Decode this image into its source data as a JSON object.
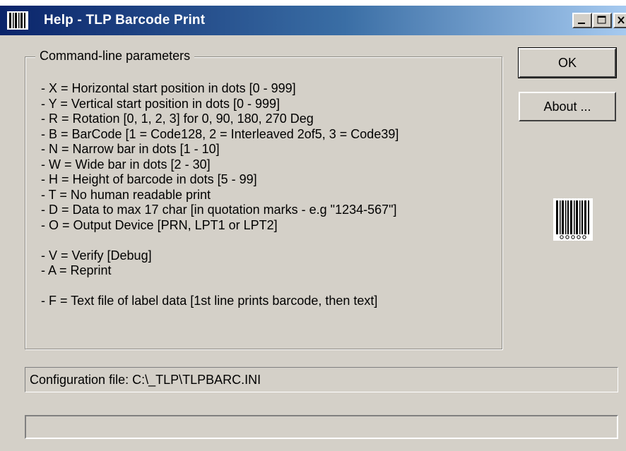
{
  "window": {
    "title": "Help - TLP Barcode Print",
    "title_bar_color": "#0a246a",
    "face_color": "#d4d0c8"
  },
  "icons": {
    "app": "barcode-icon",
    "minimize": "minimize-icon",
    "maximize": "maximize-icon",
    "close": "close-icon",
    "decoration": "barcode-icon"
  },
  "group": {
    "legend": "Command-line parameters",
    "params": [
      "- X = Horizontal start position in dots [0 - 999]",
      "- Y = Vertical start position in dots [0 - 999]",
      "- R = Rotation [0, 1, 2, 3] for 0, 90, 180, 270 Deg",
      "- B = BarCode [1 = Code128, 2 = Interleaved 2of5, 3 = Code39]",
      "- N = Narrow bar in dots [1 - 10]",
      "- W = Wide bar in dots [2 - 30]",
      "- H = Height of barcode in dots [5 - 99]",
      "- T = No human readable print",
      "- D = Data to max 17 char [in quotation marks - e.g \"1234-567\"]",
      "- O = Output Device [PRN, LPT1 or LPT2]",
      "- V = Verify [Debug]",
      "- A = Reprint",
      "- F = Text file of label data [1st line prints barcode, then text]"
    ]
  },
  "buttons": {
    "ok": "OK",
    "about": "About ..."
  },
  "status": {
    "config": "Configuration file: C:\\_TLP\\TLPBARC.INI"
  },
  "progress": {
    "value_percent": 0
  }
}
